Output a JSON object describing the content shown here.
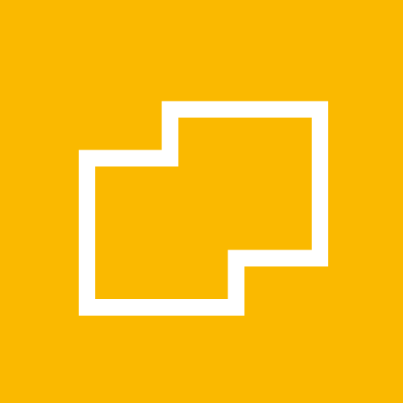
{
  "app_icon": {
    "icon_name": "stepped-outline-shape-icon",
    "colors": {
      "background": "#FAB900",
      "stroke": "#FFFFFF"
    }
  }
}
